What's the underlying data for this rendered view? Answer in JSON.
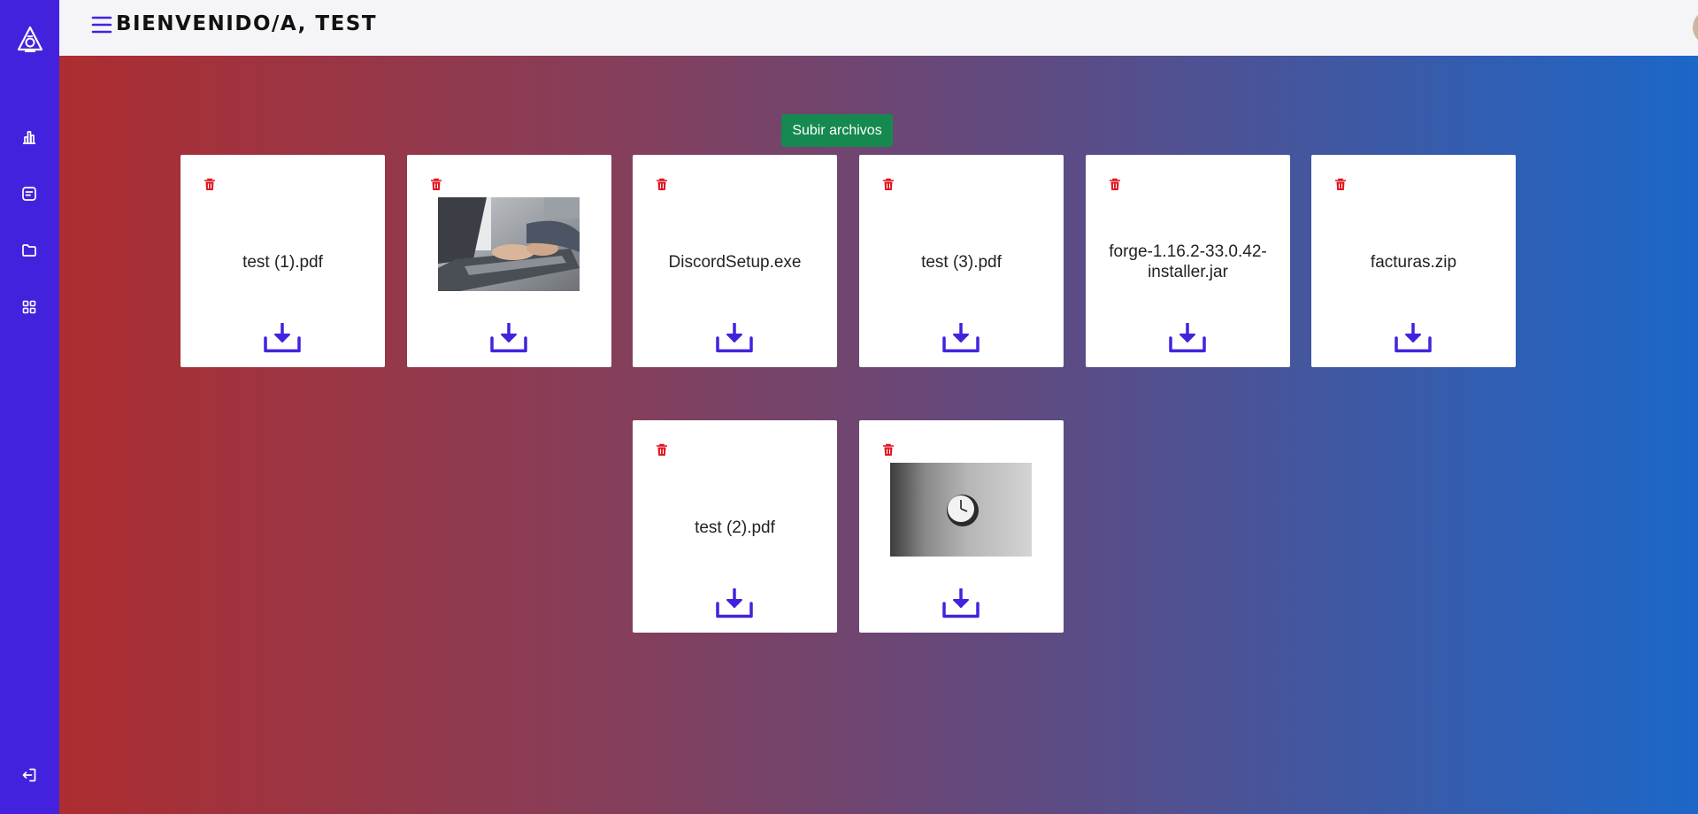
{
  "header": {
    "welcome": "Bienvenido/a, test"
  },
  "icons": {
    "logo": "logo-icon",
    "menu": "hamburger-menu-icon",
    "stats": "bar-chart-icon",
    "notes": "note-icon",
    "folder": "folder-icon",
    "apps": "grid-icon",
    "logout": "logout-icon",
    "trash": "trash-icon",
    "download": "download-icon"
  },
  "colors": {
    "sidebar": "#4422dd",
    "accent": "#4422dd",
    "upload_button": "#158950",
    "delete": "#e0141e"
  },
  "toolbar": {
    "upload_label": "Subir archivos"
  },
  "files": [
    {
      "name": "test (1).pdf",
      "kind": "document"
    },
    {
      "name": "",
      "kind": "image",
      "image": "laptop-typing-photo"
    },
    {
      "name": "DiscordSetup.exe",
      "kind": "document"
    },
    {
      "name": "test (3).pdf",
      "kind": "document"
    },
    {
      "name": "forge-1.16.2-33.0.42-installer.jar",
      "kind": "document"
    },
    {
      "name": "facturas.zip",
      "kind": "document"
    },
    {
      "name": "test (2).pdf",
      "kind": "document"
    },
    {
      "name": "",
      "kind": "image",
      "image": "wall-clock-photo"
    }
  ]
}
